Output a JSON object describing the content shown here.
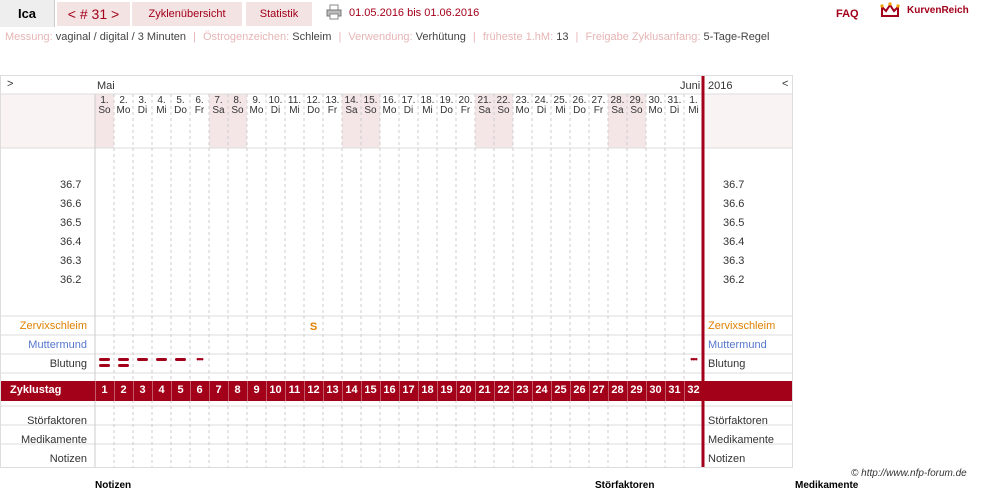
{
  "topbar": {
    "name": "Ica",
    "cycle_tab": "< # 31 >",
    "overview_tab": "Zyklenübersicht",
    "stats_tab": "Statistik",
    "date_range": "01.05.2016 bis 01.06.2016",
    "faq": "FAQ",
    "brand": "KurvenReich"
  },
  "info": {
    "messung_label": "Messung:",
    "messung_value": "vaginal / digital / 3 Minuten",
    "oestrogen_label": "Östrogenzeichen:",
    "oestrogen_value": "Schleim",
    "verwendung_label": "Verwendung:",
    "verwendung_value": "Verhütung",
    "hm_label": "früheste 1.hM:",
    "hm_value": "13",
    "freigabe_label": "Freigabe Zyklusanfang:",
    "freigabe_value": "5-Tage-Regel"
  },
  "chart": {
    "nav_left": ">",
    "nav_right": "<",
    "month_start": "Mai",
    "month_end": "Juni",
    "year": "2016",
    "days": [
      {
        "d": "1.",
        "w": "So",
        "we": true
      },
      {
        "d": "2.",
        "w": "Mo",
        "we": false
      },
      {
        "d": "3.",
        "w": "Di",
        "we": false
      },
      {
        "d": "4.",
        "w": "Mi",
        "we": false
      },
      {
        "d": "5.",
        "w": "Do",
        "we": false
      },
      {
        "d": "6.",
        "w": "Fr",
        "we": false
      },
      {
        "d": "7.",
        "w": "Sa",
        "we": true
      },
      {
        "d": "8.",
        "w": "So",
        "we": true
      },
      {
        "d": "9.",
        "w": "Mo",
        "we": false
      },
      {
        "d": "10.",
        "w": "Di",
        "we": false
      },
      {
        "d": "11.",
        "w": "Mi",
        "we": false
      },
      {
        "d": "12.",
        "w": "Do",
        "we": false
      },
      {
        "d": "13.",
        "w": "Fr",
        "we": false
      },
      {
        "d": "14.",
        "w": "Sa",
        "we": true
      },
      {
        "d": "15.",
        "w": "So",
        "we": true
      },
      {
        "d": "16.",
        "w": "Mo",
        "we": false
      },
      {
        "d": "17.",
        "w": "Di",
        "we": false
      },
      {
        "d": "18.",
        "w": "Mi",
        "we": false
      },
      {
        "d": "19.",
        "w": "Do",
        "we": false
      },
      {
        "d": "20.",
        "w": "Fr",
        "we": false
      },
      {
        "d": "21.",
        "w": "Sa",
        "we": true
      },
      {
        "d": "22.",
        "w": "So",
        "we": true
      },
      {
        "d": "23.",
        "w": "Mo",
        "we": false
      },
      {
        "d": "24.",
        "w": "Di",
        "we": false
      },
      {
        "d": "25.",
        "w": "Mi",
        "we": false
      },
      {
        "d": "26.",
        "w": "Do",
        "we": false
      },
      {
        "d": "27.",
        "w": "Fr",
        "we": false
      },
      {
        "d": "28.",
        "w": "Sa",
        "we": true
      },
      {
        "d": "29.",
        "w": "So",
        "we": true
      },
      {
        "d": "30.",
        "w": "Mo",
        "we": false
      },
      {
        "d": "31.",
        "w": "Di",
        "we": false
      },
      {
        "d": "1.",
        "w": "Mi",
        "we": false
      }
    ],
    "temps": [
      "36.7",
      "36.6",
      "36.5",
      "36.4",
      "36.3",
      "36.2"
    ],
    "zervix_label": "Zervixschleim",
    "zervix_mark": "S",
    "zervix_mark_day": 12,
    "mutter_label": "Muttermund",
    "blutung_label": "Blutung",
    "blutung": [
      {
        "day": 1,
        "kind": "heavy"
      },
      {
        "day": 2,
        "kind": "heavy"
      },
      {
        "day": 3,
        "kind": "medium"
      },
      {
        "day": 4,
        "kind": "medium"
      },
      {
        "day": 5,
        "kind": "medium"
      },
      {
        "day": 6,
        "kind": "spot"
      },
      {
        "day": 32,
        "kind": "spot"
      }
    ],
    "zyklustag_label": "Zyklustag",
    "zyklustage": [
      "1",
      "2",
      "3",
      "4",
      "5",
      "6",
      "7",
      "8",
      "9",
      "10",
      "11",
      "12",
      "13",
      "14",
      "15",
      "16",
      "17",
      "18",
      "19",
      "20",
      "21",
      "22",
      "23",
      "24",
      "25",
      "26",
      "27",
      "28",
      "29",
      "30",
      "31",
      "32"
    ],
    "stoer_label": "Störfaktoren",
    "medi_label": "Medikamente",
    "notizen_label": "Notizen"
  },
  "footer": {
    "credit": "© http://www.nfp-forum.de",
    "notizen": "Notizen",
    "stoer": "Störfaktoren",
    "medi": "Medikamente"
  },
  "colors": {
    "accent": "#a3001a",
    "weekend": "#f4e6e6",
    "zervix": "#e08000",
    "mutter": "#5577cc"
  }
}
